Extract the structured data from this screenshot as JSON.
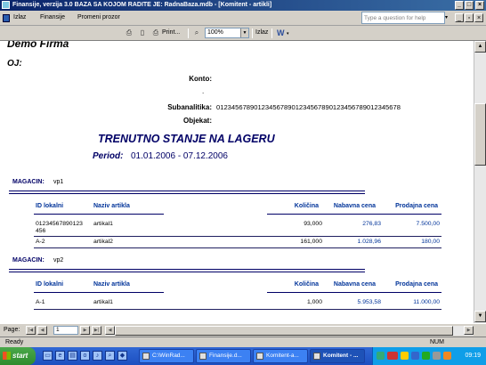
{
  "window": {
    "title": "Finansije, verzija 3.0     BAZA SA KOJOM RADITE JE: RadnaBaza.mdb - [Komitent - artikli]"
  },
  "menu": {
    "items": [
      "Izlaz",
      "Finansije",
      "Promeni prozor"
    ],
    "help_placeholder": "Type a question for help"
  },
  "toolbar": {
    "print_label": "Print...",
    "zoom_value": "100%",
    "close_label": "Izlaz",
    "word_label": "W"
  },
  "report": {
    "company": "Demo Firma",
    "oj_label": "OJ:",
    "konto_label": "Konto:",
    "konto_value": ".",
    "subanalitika_label": "Subanalitika:",
    "subanalitika_value": "0123456789012345678901234567890123456789012345678",
    "objekat_label": "Objekat:",
    "title": "TRENUTNO STANJE NA LAGERU",
    "period_label": "Period:",
    "period_value": "01.01.2006 - 07.12.2006",
    "columns": {
      "id": "ID lokalni",
      "name": "Naziv artikla",
      "qty": "Količina",
      "buy": "Nabavna cena",
      "sell": "Prodajna cena"
    },
    "groups": [
      {
        "magacin_label": "MAGACIN:",
        "magacin_value": "vp1",
        "rows": [
          {
            "id": "01234567890123\n456",
            "name": "artikal1",
            "qty": "93,000",
            "buy": "276,83",
            "sell": "7.500,00"
          },
          {
            "id": "A-2",
            "name": "artikal2",
            "qty": "161,000",
            "buy": "1.028,96",
            "sell": "180,00"
          }
        ]
      },
      {
        "magacin_label": "MAGACIN:",
        "magacin_value": "vp2",
        "rows": [
          {
            "id": "A-1",
            "name": "artikal1",
            "qty": "1,000",
            "buy": "5.953,58",
            "sell": "11.000,00"
          }
        ]
      }
    ]
  },
  "pager": {
    "label": "Page:",
    "current": "1"
  },
  "status": {
    "left": "Ready",
    "num": "NUM"
  },
  "taskbar": {
    "start": "start",
    "tasks": [
      "C:\\WinRad...",
      "Finansije.d...",
      "Komitent-a...",
      "Komitent - ..."
    ],
    "clock": "09:19"
  },
  "colors": {
    "report_title": "#000066",
    "titlebar": "#0a246a",
    "taskbar": "#245edb"
  }
}
